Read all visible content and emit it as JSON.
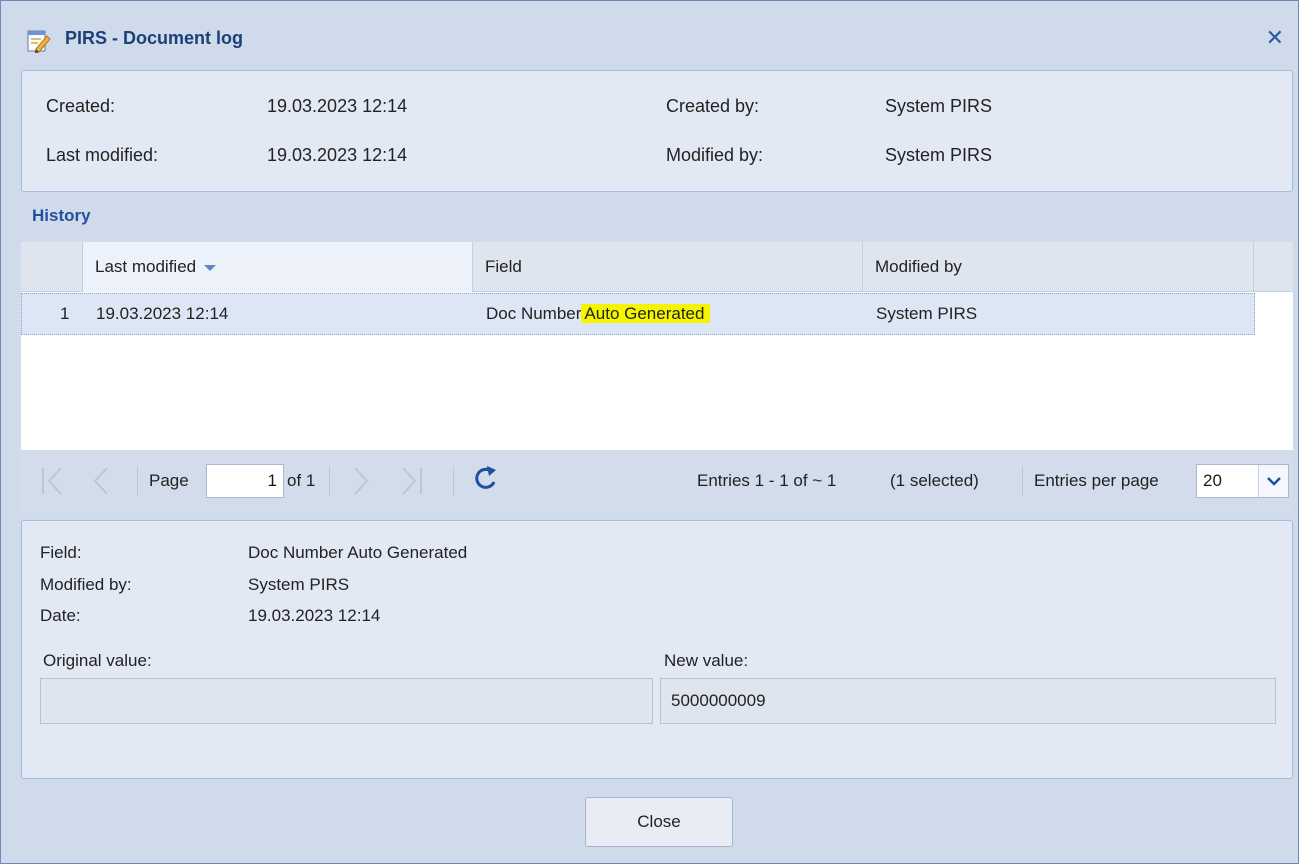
{
  "window": {
    "title": "PIRS - Document log"
  },
  "summary": {
    "created_label": "Created:",
    "created_value": "19.03.2023 12:14",
    "last_modified_label": "Last modified:",
    "last_modified_value": "19.03.2023 12:14",
    "created_by_label": "Created by:",
    "created_by_value": "System PIRS",
    "modified_by_label": "Modified by:",
    "modified_by_value": "System PIRS"
  },
  "history": {
    "title": "History",
    "columns": [
      "Last modified",
      "Field",
      "Modified by"
    ],
    "sorted_column": "Last modified",
    "rows": [
      {
        "num": "1",
        "last_modified": "19.03.2023 12:14",
        "field_prefix": "Doc Number",
        "field_highlight": "Auto Generated",
        "modified_by": "System PIRS"
      }
    ]
  },
  "pager": {
    "page_label": "Page",
    "page_value": "1",
    "of_label": "of 1",
    "entries_text": "Entries 1 - 1 of ~ 1",
    "selected_text": "(1 selected)",
    "per_page_label": "Entries per page",
    "per_page_value": "20"
  },
  "details": {
    "field_label": "Field:",
    "field_value": "Doc Number Auto Generated",
    "modified_by_label": "Modified by:",
    "modified_by_value": "System PIRS",
    "date_label": "Date:",
    "date_value": "19.03.2023 12:14",
    "original_value_label": "Original value:",
    "original_value": "",
    "new_value_label": "New value:",
    "new_value": "5000000009"
  },
  "footer": {
    "close_label": "Close"
  },
  "colors": {
    "accent": "#2450a0",
    "highlight": "#f5f500",
    "window_bg": "#cfdaea"
  },
  "icons": [
    "document-edit-icon",
    "close-icon",
    "first-page-icon",
    "prev-page-icon",
    "next-page-icon",
    "last-page-icon",
    "refresh-icon",
    "chevron-down-icon",
    "sort-desc-icon"
  ]
}
